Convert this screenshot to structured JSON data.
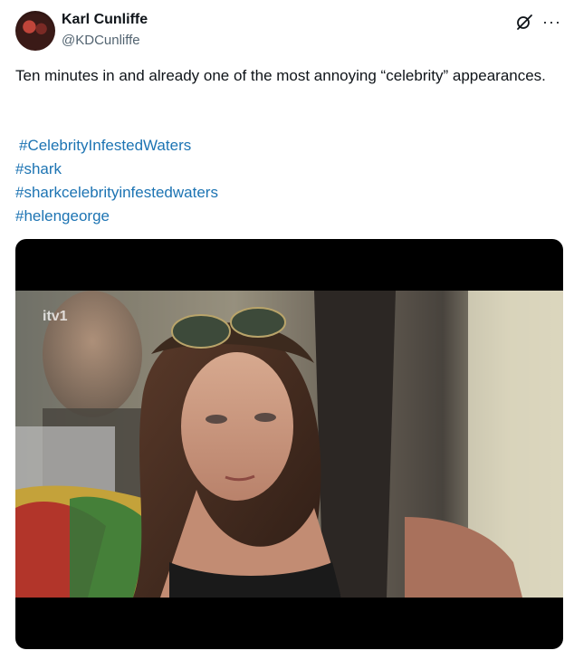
{
  "author": {
    "name": "Karl Cunliffe",
    "handle": "@KDCunliffe"
  },
  "icons": {
    "grok": "grok-icon",
    "more": "more-icon"
  },
  "tweet": {
    "text": "Ten minutes in and already one of the most annoying “celebrity” appearances.",
    "hashtags": [
      "#CelebrityInfestedWaters",
      "#shark",
      "#sharkcelebrityinfestedwaters",
      "#helengeorge"
    ]
  },
  "media": {
    "watermark": "itv1"
  },
  "colors": {
    "link": "#1d74b3",
    "text": "#0f1419",
    "secondary": "#536471"
  }
}
